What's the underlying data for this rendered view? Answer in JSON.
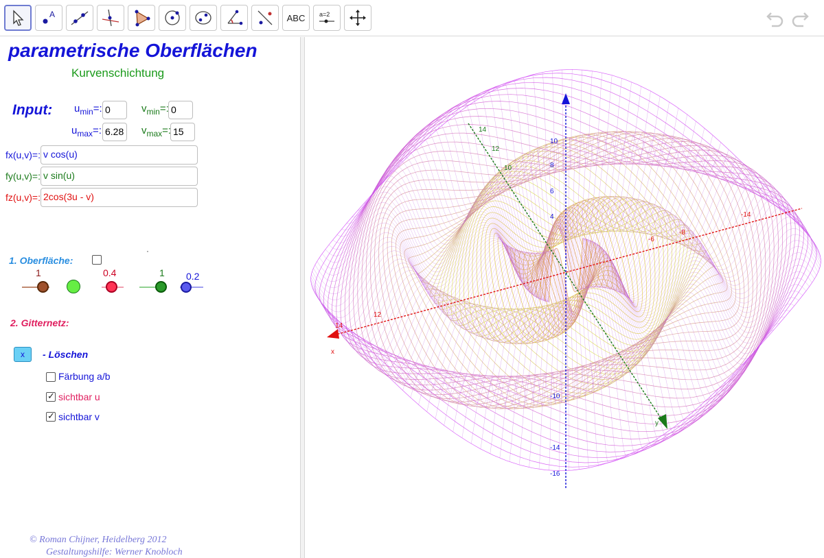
{
  "toolbar": {
    "tools": [
      {
        "name": "move-tool",
        "icon": "cursor-arrow-icon"
      },
      {
        "name": "point-tool",
        "icon": "point-a-icon",
        "label": "A"
      },
      {
        "name": "line-tool",
        "icon": "line-through-points-icon"
      },
      {
        "name": "perpendicular-tool",
        "icon": "perpendicular-lines-icon"
      },
      {
        "name": "polygon-tool",
        "icon": "polygon-icon"
      },
      {
        "name": "circle-tool",
        "icon": "circle-center-icon"
      },
      {
        "name": "ellipse-tool",
        "icon": "ellipse-icon"
      },
      {
        "name": "angle-tool",
        "icon": "angle-icon"
      },
      {
        "name": "reflect-tool",
        "icon": "reflect-about-line-icon"
      },
      {
        "name": "text-tool",
        "icon": "text-abc-icon",
        "label": "ABC"
      },
      {
        "name": "slider-tool",
        "icon": "slider-icon",
        "label": "a=2"
      },
      {
        "name": "move-graphics-tool",
        "icon": "move-arrows-icon"
      }
    ],
    "undo_icon": "undo-icon",
    "redo_icon": "redo-icon"
  },
  "algebra": {
    "title": "parametrische Oberflächen",
    "subtitle": "Kurvenschichtung",
    "input_label": "Input:",
    "params": {
      "umin": {
        "base": "u",
        "sub": "min",
        "eq": "=:",
        "value": "0"
      },
      "vmin": {
        "base": "v",
        "sub": "min",
        "eq": "=:",
        "value": "0"
      },
      "umax": {
        "base": "u",
        "sub": "max",
        "eq": "=:",
        "value": "6.28"
      },
      "vmax": {
        "base": "v",
        "sub": "max",
        "eq": "=:",
        "value": "15"
      }
    },
    "functions": [
      {
        "label": "fx(u,v)=:",
        "value": "v cos(u)",
        "color": "#1414d8"
      },
      {
        "label": "fy(u,v)=:",
        "value": "v sin(u)",
        "color": "#1a7a1a"
      },
      {
        "label": "fz(u,v)=:",
        "value": "2cos(3u - v)",
        "color": "#e01010"
      }
    ],
    "section1": {
      "label": "1. Oberfläche:",
      "color": "#2a8ee0",
      "dot_mark": "·"
    },
    "sliders": [
      {
        "value": "1",
        "color": "#8b3a0a",
        "fill": "#a0522d",
        "value_color": "#8b1a1a"
      },
      {
        "value": "",
        "color": "#1a9a1a",
        "fill": "#66ee44",
        "value_color": "#1a7a1a"
      },
      {
        "value": "0.4",
        "color": "#cc0022",
        "fill": "#ff3355",
        "value_color": "#cc0022"
      },
      {
        "value": "1",
        "color": "#1a7a1a",
        "fill": "#2a9a2a",
        "value_color": "#1a7a1a"
      },
      {
        "value": "0.2",
        "color": "#1414d8",
        "fill": "#5a5aee",
        "value_color": "#1414d8"
      }
    ],
    "section2": {
      "label": "2. Gitternetz:",
      "color": "#e02060"
    },
    "loeschen": {
      "button": "x",
      "label": "- Löschen"
    },
    "checkboxes": [
      {
        "label": "Färbung a/b",
        "checked": false,
        "color": "#1414d8"
      },
      {
        "label": "sichtbar u",
        "checked": true,
        "color": "#e02060"
      },
      {
        "label": "sichtbar v",
        "checked": true,
        "color": "#1414d8"
      }
    ],
    "credit1": "© Roman Chijner, Heidelberg 2012",
    "credit2": "Gestaltungshilfe: Werner Knobloch"
  },
  "graphics3d": {
    "surface_colors": {
      "outer": "#c040f0",
      "mid": "#f0e060",
      "inner": "#d07020"
    },
    "z_axis_ticks": [
      "10",
      "8",
      "6",
      "4",
      "-10",
      "-14",
      "-16"
    ],
    "x_axis_ticks": [
      "-14",
      "-6",
      "-8",
      "14",
      "12"
    ],
    "y_axis_ticks": [
      "14",
      "12",
      "10"
    ],
    "y_axis_label": "y",
    "x_axis_label": "x",
    "axis_colors": {
      "x": "#e01010",
      "y": "#1a7a1a",
      "z": "#1414d8"
    }
  }
}
